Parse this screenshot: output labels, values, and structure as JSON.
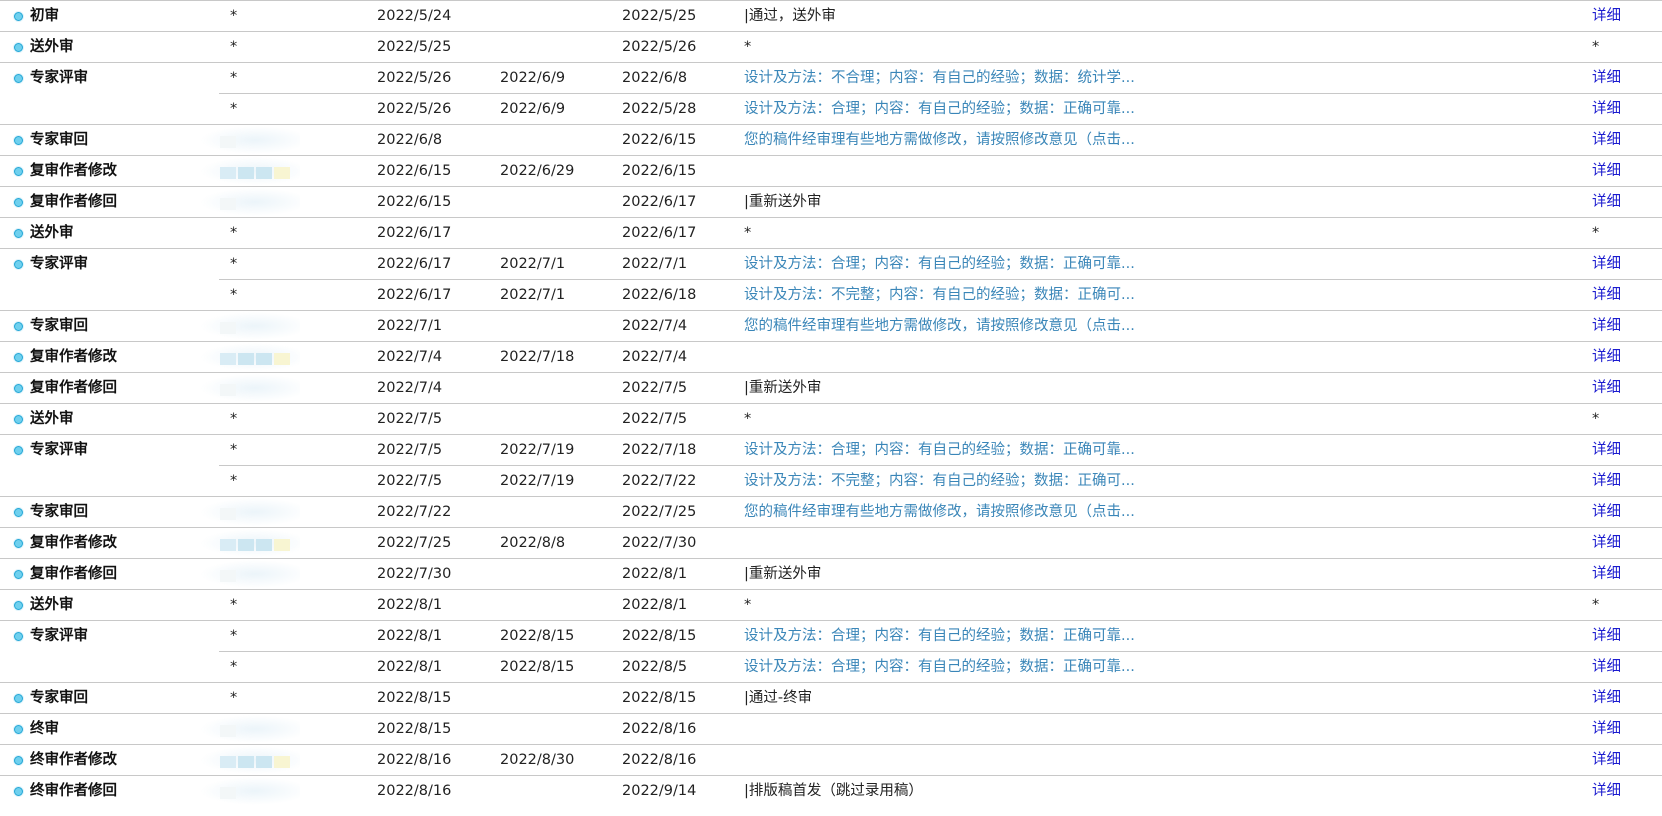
{
  "detail_label": "详细",
  "rows": [
    {
      "type": "main",
      "stage": "初审",
      "handler": "*",
      "send": "2022/5/24",
      "due": "",
      "done": "2022/5/25",
      "remark": "|通过，送外审",
      "remark_link": false,
      "detail": "详细"
    },
    {
      "type": "main",
      "stage": "送外审",
      "handler": "*",
      "send": "2022/5/25",
      "due": "",
      "done": "2022/5/26",
      "remark": "*",
      "remark_link": false,
      "detail": "*"
    },
    {
      "type": "main",
      "stage": "专家评审",
      "handler": "*",
      "send": "2022/5/26",
      "due": "2022/6/9",
      "done": "2022/6/8",
      "remark": "设计及方法：不合理；内容：有自己的经验；数据：统计学...",
      "remark_link": true,
      "detail": "详细"
    },
    {
      "type": "sub",
      "stage": "",
      "handler": "*",
      "send": "2022/5/26",
      "due": "2022/6/9",
      "done": "2022/5/28",
      "remark": "设计及方法：合理；内容：有自己的经验；数据：正确可靠...",
      "remark_link": true,
      "detail": "详细"
    },
    {
      "type": "main",
      "stage": "专家审回",
      "handler": "",
      "send": "2022/6/8",
      "due": "",
      "done": "2022/6/15",
      "remark": "您的稿件经审理有些地方需做修改，请按照修改意见（点击...",
      "remark_link": true,
      "detail": "详细"
    },
    {
      "type": "main",
      "stage": "复审作者修改",
      "handler": "",
      "send": "2022/6/15",
      "due": "2022/6/29",
      "done": "2022/6/15",
      "remark": "",
      "remark_link": false,
      "detail": "详细"
    },
    {
      "type": "main",
      "stage": "复审作者修回",
      "handler": "",
      "send": "2022/6/15",
      "due": "",
      "done": "2022/6/17",
      "remark": "|重新送外审",
      "remark_link": false,
      "detail": "详细"
    },
    {
      "type": "main",
      "stage": "送外审",
      "handler": "*",
      "send": "2022/6/17",
      "due": "",
      "done": "2022/6/17",
      "remark": "*",
      "remark_link": false,
      "detail": "*"
    },
    {
      "type": "main",
      "stage": "专家评审",
      "handler": "*",
      "send": "2022/6/17",
      "due": "2022/7/1",
      "done": "2022/7/1",
      "remark": "设计及方法：合理；内容：有自己的经验；数据：正确可靠...",
      "remark_link": true,
      "detail": "详细"
    },
    {
      "type": "sub",
      "stage": "",
      "handler": "*",
      "send": "2022/6/17",
      "due": "2022/7/1",
      "done": "2022/6/18",
      "remark": "设计及方法：不完整；内容：有自己的经验；数据：正确可...",
      "remark_link": true,
      "detail": "详细"
    },
    {
      "type": "main",
      "stage": "专家审回",
      "handler": "",
      "send": "2022/7/1",
      "due": "",
      "done": "2022/7/4",
      "remark": "您的稿件经审理有些地方需做修改，请按照修改意见（点击...",
      "remark_link": true,
      "detail": "详细"
    },
    {
      "type": "main",
      "stage": "复审作者修改",
      "handler": "",
      "send": "2022/7/4",
      "due": "2022/7/18",
      "done": "2022/7/4",
      "remark": "",
      "remark_link": false,
      "detail": "详细"
    },
    {
      "type": "main",
      "stage": "复审作者修回",
      "handler": "",
      "send": "2022/7/4",
      "due": "",
      "done": "2022/7/5",
      "remark": "|重新送外审",
      "remark_link": false,
      "detail": "详细"
    },
    {
      "type": "main",
      "stage": "送外审",
      "handler": "*",
      "send": "2022/7/5",
      "due": "",
      "done": "2022/7/5",
      "remark": "*",
      "remark_link": false,
      "detail": "*"
    },
    {
      "type": "main",
      "stage": "专家评审",
      "handler": "*",
      "send": "2022/7/5",
      "due": "2022/7/19",
      "done": "2022/7/18",
      "remark": "设计及方法：合理；内容：有自己的经验；数据：正确可靠...",
      "remark_link": true,
      "detail": "详细"
    },
    {
      "type": "sub",
      "stage": "",
      "handler": "*",
      "send": "2022/7/5",
      "due": "2022/7/19",
      "done": "2022/7/22",
      "remark": "设计及方法：不完整；内容：有自己的经验；数据：正确可...",
      "remark_link": true,
      "detail": "详细"
    },
    {
      "type": "main",
      "stage": "专家审回",
      "handler": "",
      "send": "2022/7/22",
      "due": "",
      "done": "2022/7/25",
      "remark": "您的稿件经审理有些地方需做修改，请按照修改意见（点击...",
      "remark_link": true,
      "detail": "详细"
    },
    {
      "type": "main",
      "stage": "复审作者修改",
      "handler": "",
      "send": "2022/7/25",
      "due": "2022/8/8",
      "done": "2022/7/30",
      "remark": "",
      "remark_link": false,
      "detail": "详细"
    },
    {
      "type": "main",
      "stage": "复审作者修回",
      "handler": "",
      "send": "2022/7/30",
      "due": "",
      "done": "2022/8/1",
      "remark": "|重新送外审",
      "remark_link": false,
      "detail": "详细"
    },
    {
      "type": "main",
      "stage": "送外审",
      "handler": "*",
      "send": "2022/8/1",
      "due": "",
      "done": "2022/8/1",
      "remark": "*",
      "remark_link": false,
      "detail": "*"
    },
    {
      "type": "main",
      "stage": "专家评审",
      "handler": "*",
      "send": "2022/8/1",
      "due": "2022/8/15",
      "done": "2022/8/15",
      "remark": "设计及方法：合理；内容：有自己的经验；数据：正确可靠...",
      "remark_link": true,
      "detail": "详细"
    },
    {
      "type": "sub",
      "stage": "",
      "handler": "*",
      "send": "2022/8/1",
      "due": "2022/8/15",
      "done": "2022/8/5",
      "remark": "设计及方法：合理；内容：有自己的经验；数据：正确可靠...",
      "remark_link": true,
      "detail": "详细"
    },
    {
      "type": "main",
      "stage": "专家审回",
      "handler": "*",
      "send": "2022/8/15",
      "due": "",
      "done": "2022/8/15",
      "remark": "|通过-终审",
      "remark_link": false,
      "detail": "详细"
    },
    {
      "type": "main",
      "stage": "终审",
      "handler": "",
      "send": "2022/8/15",
      "due": "",
      "done": "2022/8/16",
      "remark": "",
      "remark_link": false,
      "detail": "详细"
    },
    {
      "type": "main",
      "stage": "终审作者修改",
      "handler": "",
      "send": "2022/8/16",
      "due": "2022/8/30",
      "done": "2022/8/16",
      "remark": "",
      "remark_link": false,
      "detail": "详细"
    },
    {
      "type": "main",
      "stage": "终审作者修回",
      "handler": "",
      "send": "2022/8/16",
      "due": "",
      "done": "2022/9/14",
      "remark": "|排版稿首发（跳过录用稿）",
      "remark_link": false,
      "detail": "详细"
    }
  ]
}
